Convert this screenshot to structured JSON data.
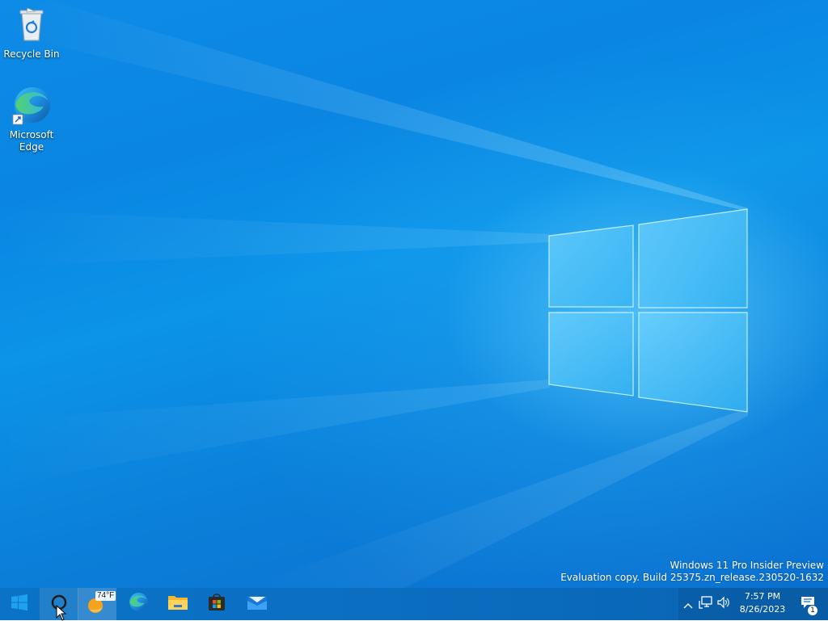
{
  "desktop": {
    "icons": [
      {
        "label": "Recycle Bin",
        "icon": "recycle-bin-icon"
      },
      {
        "label": "Microsoft Edge",
        "icon": "edge-icon"
      }
    ],
    "watermark": {
      "line1": "Windows 11 Pro Insider Preview",
      "line2": "Evaluation copy. Build 25375.zn_release.230520-1632"
    },
    "colors": {
      "sky": "#0b8fe6",
      "logo_glow": "#9be6ff"
    }
  },
  "taskbar": {
    "start_icon": "windows-logo-icon",
    "search_icon": "search-circle-icon",
    "weather": {
      "temperature": "74°F",
      "icon": "weather-sun-icon"
    },
    "pinned": [
      {
        "name": "Microsoft Edge",
        "icon": "edge-icon"
      },
      {
        "name": "File Explorer",
        "icon": "folder-icon"
      },
      {
        "name": "Microsoft Store",
        "icon": "store-icon"
      },
      {
        "name": "Mail",
        "icon": "mail-icon"
      }
    ],
    "tray": {
      "icons": [
        "chevron-up-icon",
        "network-icon",
        "volume-icon"
      ],
      "time": "7:57 PM",
      "date": "8/26/2023",
      "notifications": "1"
    }
  }
}
